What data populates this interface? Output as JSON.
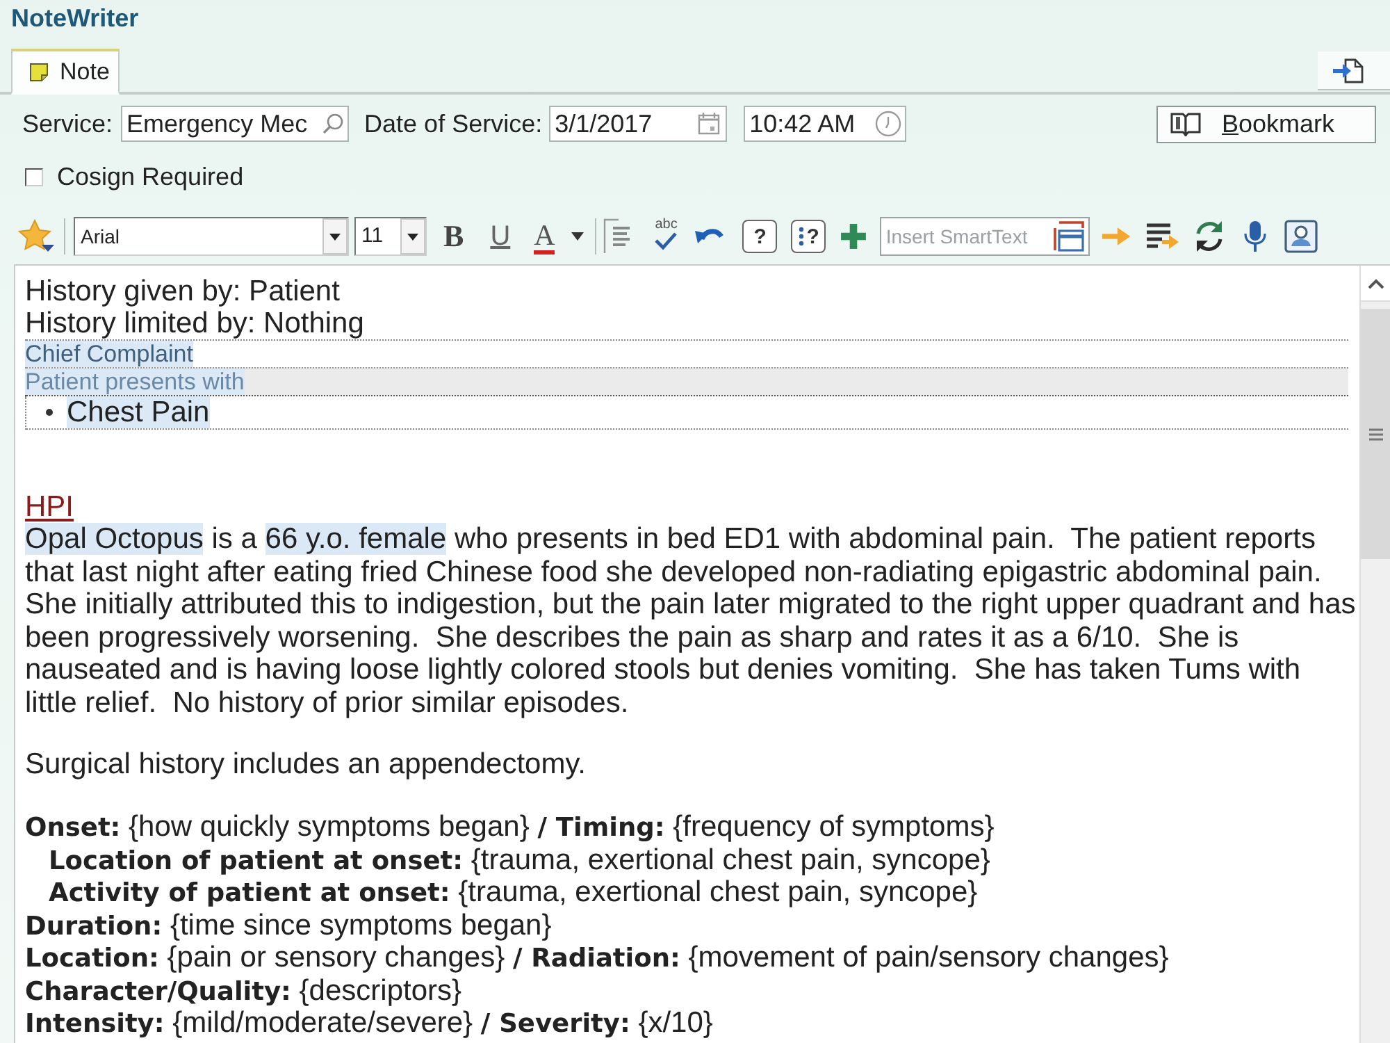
{
  "app": {
    "title": "NoteWriter"
  },
  "tabs": [
    {
      "label": "Note",
      "selected": true
    }
  ],
  "header": {
    "service": {
      "label": "Service:",
      "value": "Emergency Mec"
    },
    "date": {
      "label": "Date of Service:",
      "value": "3/1/2017"
    },
    "time": {
      "value": "10:42 AM"
    },
    "bookmark": {
      "label": "Bookmark"
    },
    "cosign": {
      "label": "Cosign Required",
      "checked": false
    }
  },
  "toolbar": {
    "font": "Arial",
    "size": "11",
    "bold": "B",
    "underline": "U",
    "font_color": "A",
    "spellcheck": "abc",
    "help_buttons": [
      {
        "kind": "plain",
        "label": "?"
      },
      {
        "kind": "dotted",
        "label": "?"
      }
    ],
    "smarttext": {
      "placeholder": "Insert SmartText"
    }
  },
  "note": {
    "history_lines": [
      "History given by: Patient",
      "History limited by: Nothing"
    ],
    "chief_complaint": {
      "heading": "Chief Complaint",
      "lead": "Patient presents with",
      "items": [
        "Chest Pain"
      ]
    },
    "hpi": {
      "heading": "HPI",
      "paragraph": [
        {
          "text": "Opal Octopus",
          "highlighted": true
        },
        {
          "text": " is a ",
          "highlighted": false
        },
        {
          "text": "66 y.o. female",
          "highlighted": true
        },
        {
          "text": " who presents in bed ED1 with abdominal pain.  The patient reports that last night after eating fried Chinese food she developed non-radiating epigastric abdominal pain.  She initially attributed this to indigestion, but the pain later migrated to the right upper quadrant and has been progressively worsening.  She describes the pain as sharp and rates it as a 6/10.  She is nauseated and is having loose lightly colored stools but denies vomiting.  She has taken Tums with little relief.  No history of prior similar episodes.",
          "highlighted": false
        }
      ]
    },
    "surgical": "Surgical history includes an appendectomy.",
    "template": [
      {
        "text": "**Onset:** {how quickly symptoms began} **/ Timing:** {frequency of symptoms}",
        "children": [
          {
            "text": "**Location of patient at onset:** {trauma, exertional chest pain, syncope}"
          },
          {
            "text": "**Activity of patient at onset:** {trauma, exertional chest pain, syncope}"
          }
        ]
      },
      {
        "text": "**Duration:** {time since symptoms began}"
      },
      {
        "text": "**Location:** {pain or sensory changes} **/ Radiation:** {movement of pain/sensory changes}"
      },
      {
        "text": "**Character/Quality:** {descriptors}"
      },
      {
        "text": "**Intensity:** {mild/moderate/severe} **/ Severity:** {x/10}"
      }
    ]
  }
}
